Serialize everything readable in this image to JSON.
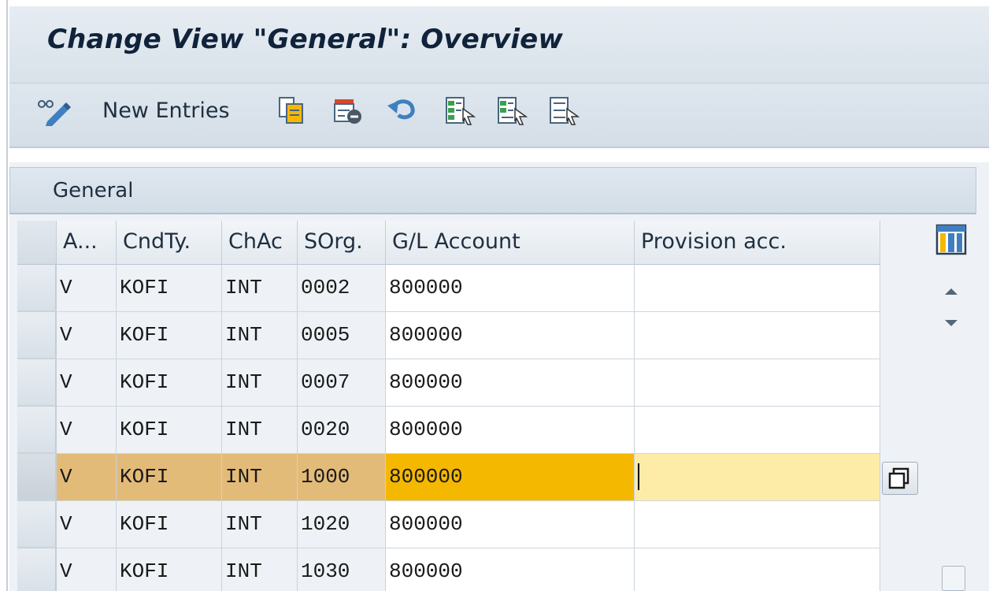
{
  "title": "Change View \"General\": Overview",
  "toolbar": {
    "new_entries_label": "New Entries",
    "icons": [
      "display-change-icon",
      "copy-icon",
      "delete-icon",
      "undo-icon",
      "select-all-icon",
      "select-block-icon",
      "deselect-all-icon"
    ]
  },
  "section": {
    "title": "General"
  },
  "columns": [
    "A...",
    "CndTy.",
    "ChAc",
    "SOrg.",
    "G/L Account",
    "Provision acc."
  ],
  "rows": [
    [
      "V",
      "KOFI",
      "INT",
      "0002",
      "800000",
      ""
    ],
    [
      "V",
      "KOFI",
      "INT",
      "0005",
      "800000",
      ""
    ],
    [
      "V",
      "KOFI",
      "INT",
      "0007",
      "800000",
      ""
    ],
    [
      "V",
      "KOFI",
      "INT",
      "0020",
      "800000",
      ""
    ],
    [
      "V",
      "KOFI",
      "INT",
      "1000",
      "800000",
      ""
    ],
    [
      "V",
      "KOFI",
      "INT",
      "1020",
      "800000",
      ""
    ],
    [
      "V",
      "KOFI",
      "INT",
      "1030",
      "800000",
      ""
    ]
  ],
  "selected_row_index": 4,
  "colors": {
    "selected_row": "#e3bb78",
    "selected_gl_cell": "#f5b800",
    "selected_provision_cell": "#fdeba8",
    "title_text": "#10233b"
  }
}
